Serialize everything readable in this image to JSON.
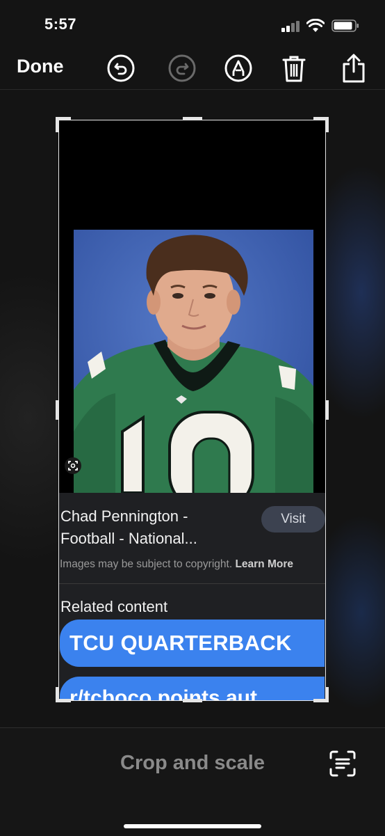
{
  "status_bar": {
    "time": "5:57"
  },
  "toolbar": {
    "done_label": "Done",
    "tools": [
      "undo-icon",
      "redo-icon",
      "markup-icon",
      "trash-icon",
      "share-icon"
    ]
  },
  "result": {
    "title_line1": "Chad Pennington -",
    "title_line2": "Football - National...",
    "visit_label": "Visit",
    "copyright_text": "Images may be subject to copyright.",
    "learn_more": "Learn More",
    "related_heading": "Related content",
    "chip1": "TCU QUARTERBACK",
    "chip2": "r/tcboco points aut"
  },
  "bottom": {
    "label": "Crop and scale"
  },
  "colors": {
    "accent_blue": "#3b82ee",
    "panel": "#1f2023",
    "visit_bg": "#3c4250"
  }
}
